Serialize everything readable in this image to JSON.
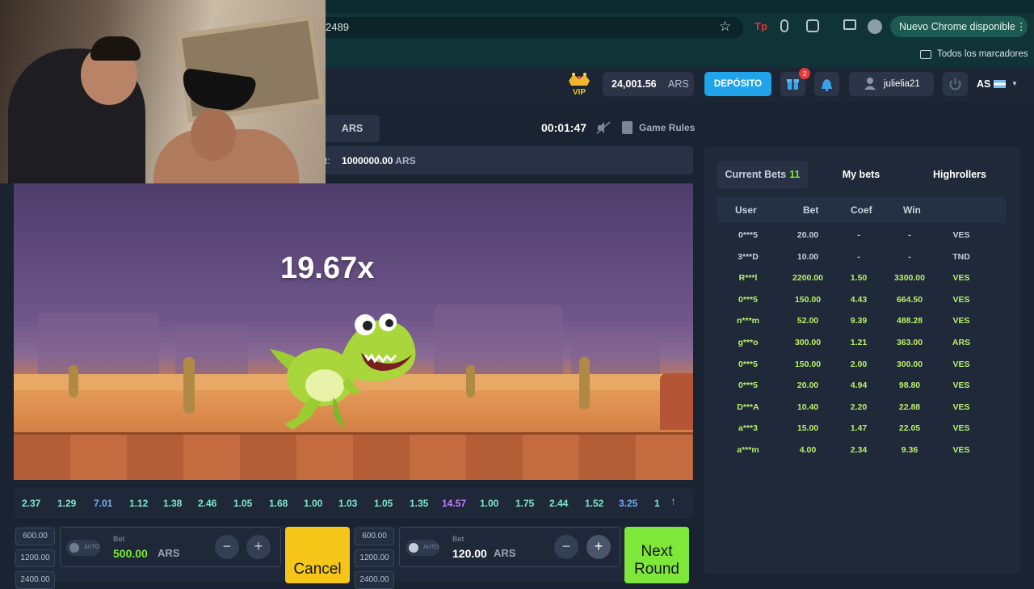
{
  "browser": {
    "url_fragment": "2489",
    "update_label": "Nuevo Chrome disponible",
    "bookmarks_label": "Todos los marcadores"
  },
  "header": {
    "balance": "24,001.56",
    "balance_currency": "ARS",
    "deposit_label": "DEPÓSITO",
    "gift_count": "2",
    "username": "julielia21",
    "lang": "AS",
    "vip_label": "VIP"
  },
  "game_info": {
    "currency_tab": "ARS",
    "timer": "00:01:47",
    "rules_label": "Game Rules",
    "max_win_label_fragment": "t:",
    "max_win_value": "1000000.00",
    "max_win_currency": "ARS"
  },
  "game": {
    "multiplier": "19.67x"
  },
  "history": [
    {
      "v": "2.37",
      "c": "#7ee8c8"
    },
    {
      "v": "1.29",
      "c": "#7ee8c8"
    },
    {
      "v": "7.01",
      "c": "#7aa7f0"
    },
    {
      "v": "1.12",
      "c": "#7ee8c8"
    },
    {
      "v": "1.38",
      "c": "#7ee8c8"
    },
    {
      "v": "2.46",
      "c": "#7ee8c8"
    },
    {
      "v": "1.05",
      "c": "#7ee8c8"
    },
    {
      "v": "1.68",
      "c": "#7ee8c8"
    },
    {
      "v": "1.00",
      "c": "#7ee8c8"
    },
    {
      "v": "1.03",
      "c": "#7ee8c8"
    },
    {
      "v": "1.05",
      "c": "#7ee8c8"
    },
    {
      "v": "1.35",
      "c": "#7ee8c8"
    },
    {
      "v": "14.57",
      "c": "#c77dff"
    },
    {
      "v": "1.00",
      "c": "#7ee8c8"
    },
    {
      "v": "1.75",
      "c": "#7ee8c8"
    },
    {
      "v": "2.44",
      "c": "#7ee8c8"
    },
    {
      "v": "1.52",
      "c": "#7ee8c8"
    },
    {
      "v": "3.25",
      "c": "#7aa7f0"
    },
    {
      "v": "1",
      "c": "#7ee8c8"
    }
  ],
  "bet_panel_1": {
    "presets": [
      "600.00",
      "1200.00",
      "2400.00"
    ],
    "auto_label": "AUTO",
    "bet_caption": "Bet",
    "amount": "500.00",
    "currency": "ARS",
    "minus": "−",
    "plus": "+",
    "action_label": "Cancel"
  },
  "bet_panel_2": {
    "presets": [
      "600.00",
      "1200.00",
      "2400.00"
    ],
    "auto_label": "AUTO",
    "bet_caption": "Bet",
    "amount": "120.00",
    "currency": "ARS",
    "minus": "−",
    "plus": "+",
    "action_label": "Next Round"
  },
  "bets": {
    "tabs": [
      {
        "label": "Current Bets",
        "count": "11"
      },
      {
        "label": "My bets"
      },
      {
        "label": "Highrollers"
      }
    ],
    "columns": [
      "User",
      "Bet",
      "Coef",
      "Win"
    ],
    "rows": [
      {
        "user": "0***5",
        "bet": "20.00",
        "coef": "-",
        "win": "-",
        "cur": "VES",
        "won": false
      },
      {
        "user": "3***D",
        "bet": "10.00",
        "coef": "-",
        "win": "-",
        "cur": "TND",
        "won": false
      },
      {
        "user": "R***l",
        "bet": "2200.00",
        "coef": "1.50",
        "win": "3300.00",
        "cur": "VES",
        "won": true
      },
      {
        "user": "0***5",
        "bet": "150.00",
        "coef": "4.43",
        "win": "664.50",
        "cur": "VES",
        "won": true
      },
      {
        "user": "n***m",
        "bet": "52.00",
        "coef": "9.39",
        "win": "488.28",
        "cur": "VES",
        "won": true
      },
      {
        "user": "g***o",
        "bet": "300.00",
        "coef": "1.21",
        "win": "363.00",
        "cur": "ARS",
        "won": true
      },
      {
        "user": "0***5",
        "bet": "150.00",
        "coef": "2.00",
        "win": "300.00",
        "cur": "VES",
        "won": true
      },
      {
        "user": "0***5",
        "bet": "20.00",
        "coef": "4.94",
        "win": "98.80",
        "cur": "VES",
        "won": true
      },
      {
        "user": "D***A",
        "bet": "10.40",
        "coef": "2.20",
        "win": "22.88",
        "cur": "VES",
        "won": true
      },
      {
        "user": "a***3",
        "bet": "15.00",
        "coef": "1.47",
        "win": "22.05",
        "cur": "VES",
        "won": true
      },
      {
        "user": "a***m",
        "bet": "4.00",
        "coef": "2.34",
        "win": "9.36",
        "cur": "VES",
        "won": true
      }
    ]
  },
  "colors": {
    "accent_green": "#7ee83a",
    "accent_blue": "#21a3ea",
    "cancel_yellow": "#f5c518"
  }
}
